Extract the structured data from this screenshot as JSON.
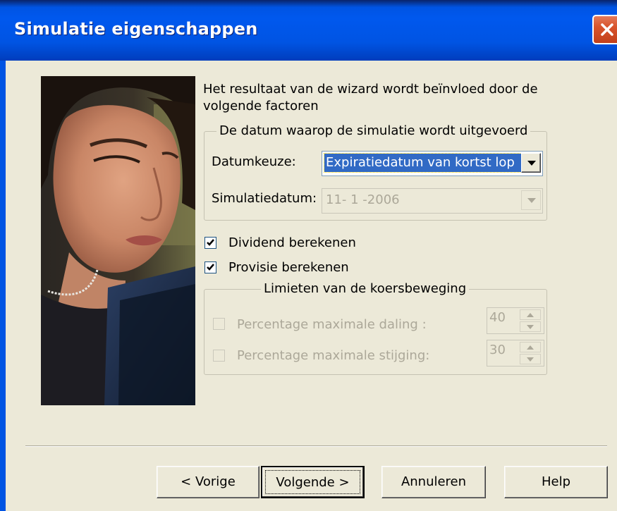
{
  "window": {
    "title": "Simulatie eigenschappen"
  },
  "intro_text": {
    "line1": "Het resultaat van de wizard wordt beïnvloed door de",
    "line2": "volgende factoren"
  },
  "date_group": {
    "title": "De datum waarop de simulatie wordt uitgevoerd",
    "datumkeuze_label": "Datumkeuze:",
    "datumkeuze_value": "Expiratiedatum van kortst lop",
    "simulatiedatum_label": "Simulatiedatum:",
    "simulatiedatum_value": "11- 1 -2006"
  },
  "options": {
    "dividend_label": "Dividend berekenen",
    "dividend_checked": true,
    "provisie_label": "Provisie berekenen",
    "provisie_checked": true
  },
  "limits_group": {
    "title": "Limieten van de koersbeweging",
    "daling_label": "Percentage maximale daling :",
    "daling_checked": false,
    "daling_value": "40",
    "stijging_label": "Percentage maximale stijging:",
    "stijging_checked": false,
    "stijging_value": "30"
  },
  "buttons": {
    "back": "< Vorige",
    "next": "Volgende >",
    "cancel": "Annuleren",
    "help": "Help"
  },
  "colors": {
    "titlebar": "#0054e3",
    "dialog_bg": "#ece9d8",
    "selection": "#316ac5",
    "close_button": "#d8542c"
  },
  "icons": {
    "close": "close-icon",
    "dropdown": "chevron-down-icon",
    "check": "checkmark-icon",
    "spin_up": "spin-up-icon",
    "spin_down": "spin-down-icon"
  }
}
